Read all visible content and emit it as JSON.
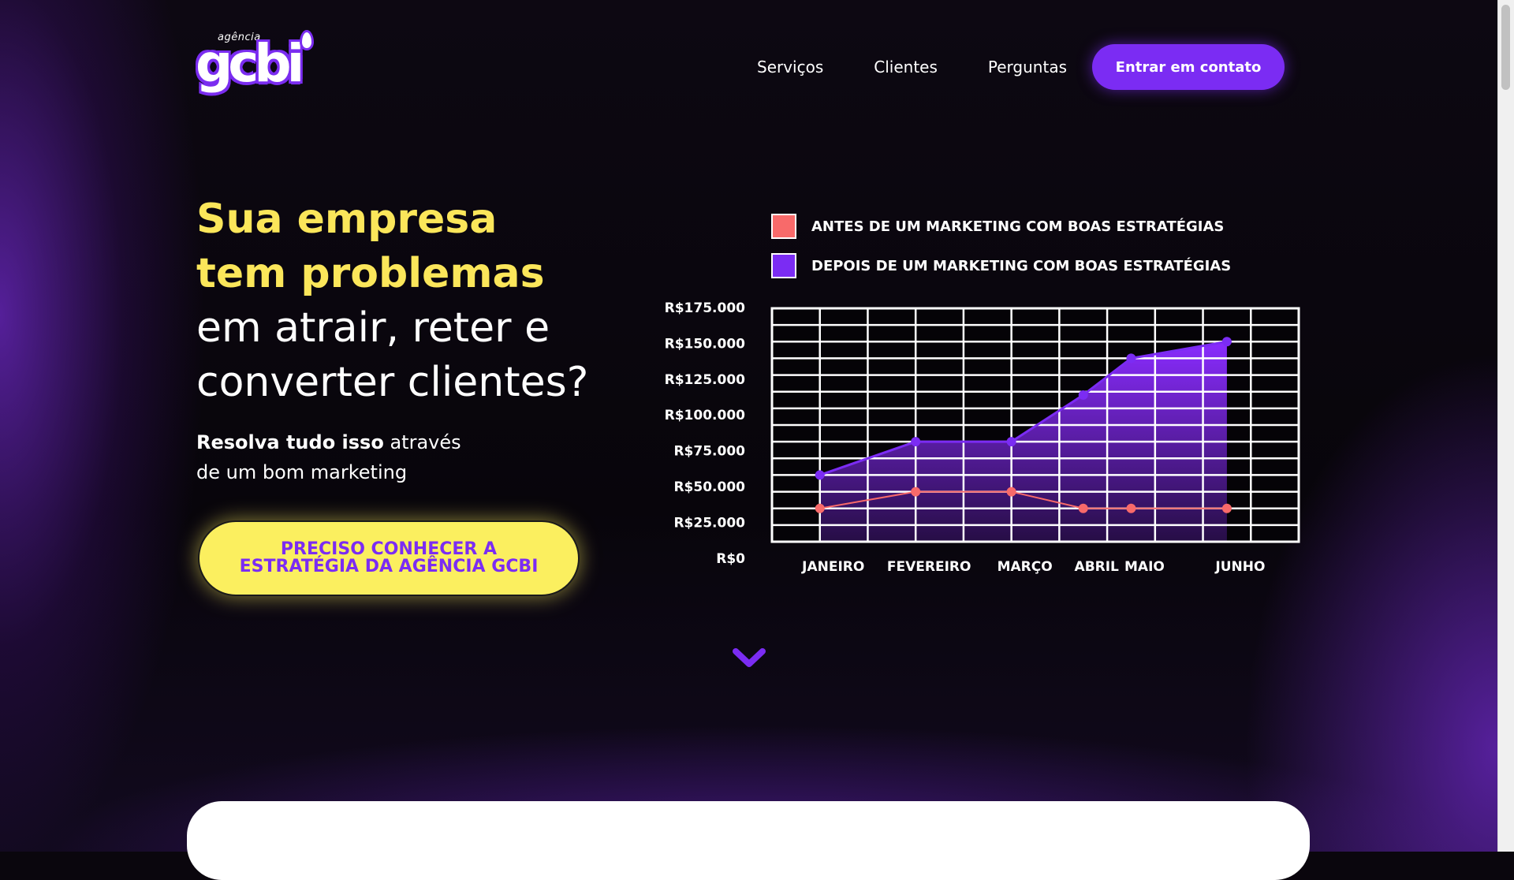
{
  "logo": {
    "small": "agência",
    "main": "gcbi"
  },
  "nav": {
    "items": [
      "Serviços",
      "Clientes",
      "Perguntas"
    ],
    "cta": "Entrar em contato"
  },
  "hero": {
    "line1": "Sua empresa",
    "line2": "tem problemas",
    "line3": "em atrair, reter e",
    "line4": "converter clientes?",
    "sub_bold": "Resolva tudo isso",
    "sub_rest1": " através",
    "sub_rest2": "de um bom marketing",
    "cta_line1": "PRECISO CONHECER A",
    "cta_line2": "ESTRATÉGIA DA AGÊNCIA GCBI"
  },
  "chart_data": {
    "type": "area",
    "categories": [
      "JANEIRO",
      "FEVEREIRO",
      "MARÇO",
      "ABRIL",
      "MAIO",
      "JUNHO"
    ],
    "x": [
      0.5,
      2.5,
      4.5,
      6.0,
      7.0,
      9.0
    ],
    "x_range": [
      -0.5,
      10.5
    ],
    "yticks": [
      "R$175.000",
      "R$150.000",
      "R$125.000",
      "R$100.000",
      "R$75.000",
      "R$50.000",
      "R$25.000",
      "R$0"
    ],
    "ylim": [
      0,
      175000
    ],
    "grid": true,
    "legend_position": "top",
    "series": [
      {
        "name": "ANTES DE UM MARKETING COM BOAS ESTRATÉGIAS",
        "values": [
          25000,
          37500,
          37500,
          25000,
          25000,
          25000
        ],
        "color": "#f86a6a"
      },
      {
        "name": "DEPOIS DE UM MARKETING COM BOAS ESTRATÉGIAS",
        "values": [
          50000,
          75000,
          75000,
          110000,
          137500,
          150000
        ],
        "color": "#7b2cf3"
      }
    ]
  },
  "colors": {
    "accent": "#7b2cf3",
    "yellow": "#fbe65a",
    "red": "#f86a6a",
    "background": "#0a060d"
  }
}
